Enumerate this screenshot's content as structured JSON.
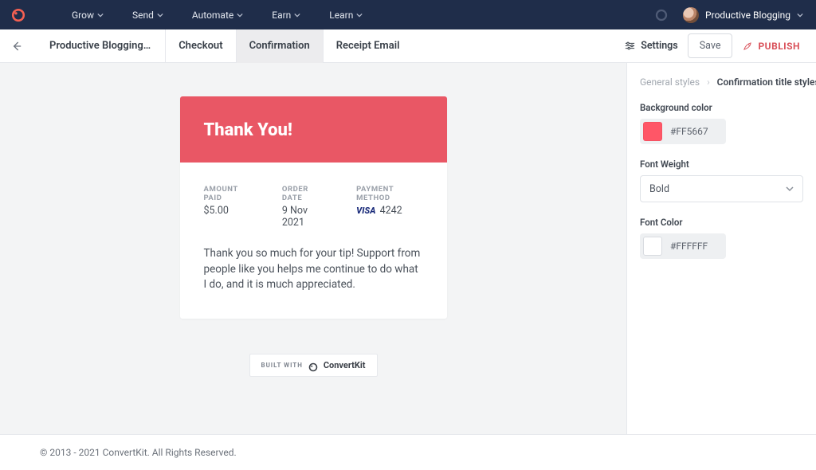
{
  "nav": {
    "links": [
      "Grow",
      "Send",
      "Automate",
      "Earn",
      "Learn"
    ],
    "account_name": "Productive Blogging"
  },
  "breadcrumb": {
    "back_product_name": "Productive Blogging…",
    "tabs": [
      "Checkout",
      "Confirmation",
      "Receipt Email"
    ]
  },
  "actions": {
    "settings_label": "Settings",
    "save_label": "Save",
    "publish_label": "PUBLISH"
  },
  "confirmation": {
    "title": "Thank You!",
    "amount_paid_label": "AMOUNT PAID",
    "amount_paid_value": "$5.00",
    "order_date_label": "ORDER DATE",
    "order_date_value": "9 Nov 2021",
    "payment_method_label": "PAYMENT METHOD",
    "card_brand": "VISA",
    "card_last4": "4242",
    "message": "Thank you so much for your tip! Support from people like you helps me continue to do what I do, and it is much appreciated."
  },
  "built_with": {
    "label": "BUILT WITH",
    "brand": "ConvertKit"
  },
  "styles_panel": {
    "crumb_prev": "General styles",
    "crumb_sep": "›",
    "crumb_current": "Confirmation title styles",
    "bg_label": "Background color",
    "bg_value": "#FF5667",
    "weight_label": "Font Weight",
    "weight_value": "Bold",
    "fontcolor_label": "Font Color",
    "fontcolor_value": "#FFFFFF"
  },
  "colors": {
    "bg_swatch": "#FF5667",
    "fontcolor_swatch": "#FFFFFF"
  },
  "footer": {
    "copyright": "© 2013 - 2021 ConvertKit. All Rights Reserved."
  }
}
